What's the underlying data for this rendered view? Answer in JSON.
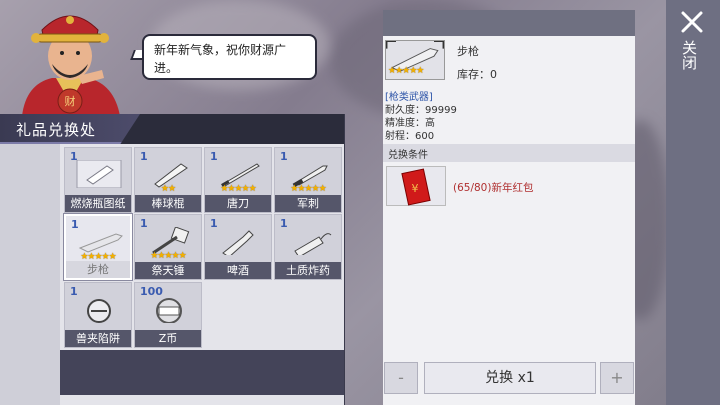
{
  "npc": {
    "dialogue": "新年新气象，祝你财源广进。"
  },
  "shop": {
    "title": "礼品兑换处",
    "items": [
      {
        "count": "1",
        "stars": "",
        "name": "燃烧瓶图纸"
      },
      {
        "count": "1",
        "stars": "★★",
        "name": "棒球棍"
      },
      {
        "count": "1",
        "stars": "★★★★★",
        "name": "唐刀"
      },
      {
        "count": "1",
        "stars": "★★★★★",
        "name": "军刺"
      },
      {
        "count": "1",
        "stars": "★★★★★",
        "name": "步枪"
      },
      {
        "count": "1",
        "stars": "★★★★★",
        "name": "祭天锤"
      },
      {
        "count": "1",
        "stars": "",
        "name": "啤酒"
      },
      {
        "count": "1",
        "stars": "",
        "name": "土质炸药"
      },
      {
        "count": "1",
        "stars": "",
        "name": "兽夹陷阱"
      },
      {
        "count": "100",
        "stars": "",
        "name": "Z币"
      }
    ]
  },
  "detail": {
    "name": "步枪",
    "stars": "★★★★★",
    "stock": "库存：0",
    "category": "[枪类武器]",
    "durability": "耐久度：99999",
    "accuracy": "精准度：高",
    "range": "射程：600",
    "condition_label": "兑换条件",
    "condition_text": "(65/80)新年红包",
    "coin_symbol": "¥"
  },
  "controls": {
    "minus": "-",
    "exchange": "兑换 x1",
    "plus": "+",
    "close": "关闭"
  },
  "colors": {
    "accent_dark": "#2b2c3b",
    "count_blue": "#3a5bb0",
    "star_gold": "#f3b000",
    "condition_red": "#b03030"
  }
}
